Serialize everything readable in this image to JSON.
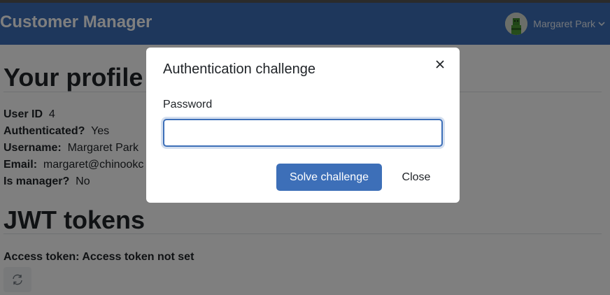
{
  "navbar": {
    "brand": "Customer Manager",
    "user_name": "Margaret Park",
    "accent": "#3d6fb8"
  },
  "profile": {
    "heading": "Your profile",
    "fields": [
      {
        "label": "User ID",
        "value": "4"
      },
      {
        "label": "Authenticated?",
        "value": "Yes"
      },
      {
        "label": "Username:",
        "value": "Margaret Park"
      },
      {
        "label": "Email:",
        "value": "margaret@chinookc"
      },
      {
        "label": "Is manager?",
        "value": "No"
      }
    ]
  },
  "tokens": {
    "heading": "JWT tokens",
    "access_token_text": "Access token: Access token not set",
    "refresh_icon": "refresh-icon"
  },
  "modal": {
    "title": "Authentication challenge",
    "password_label": "Password",
    "password_value": "",
    "solve_label": "Solve challenge",
    "close_label": "Close",
    "close_icon": "close-icon"
  }
}
